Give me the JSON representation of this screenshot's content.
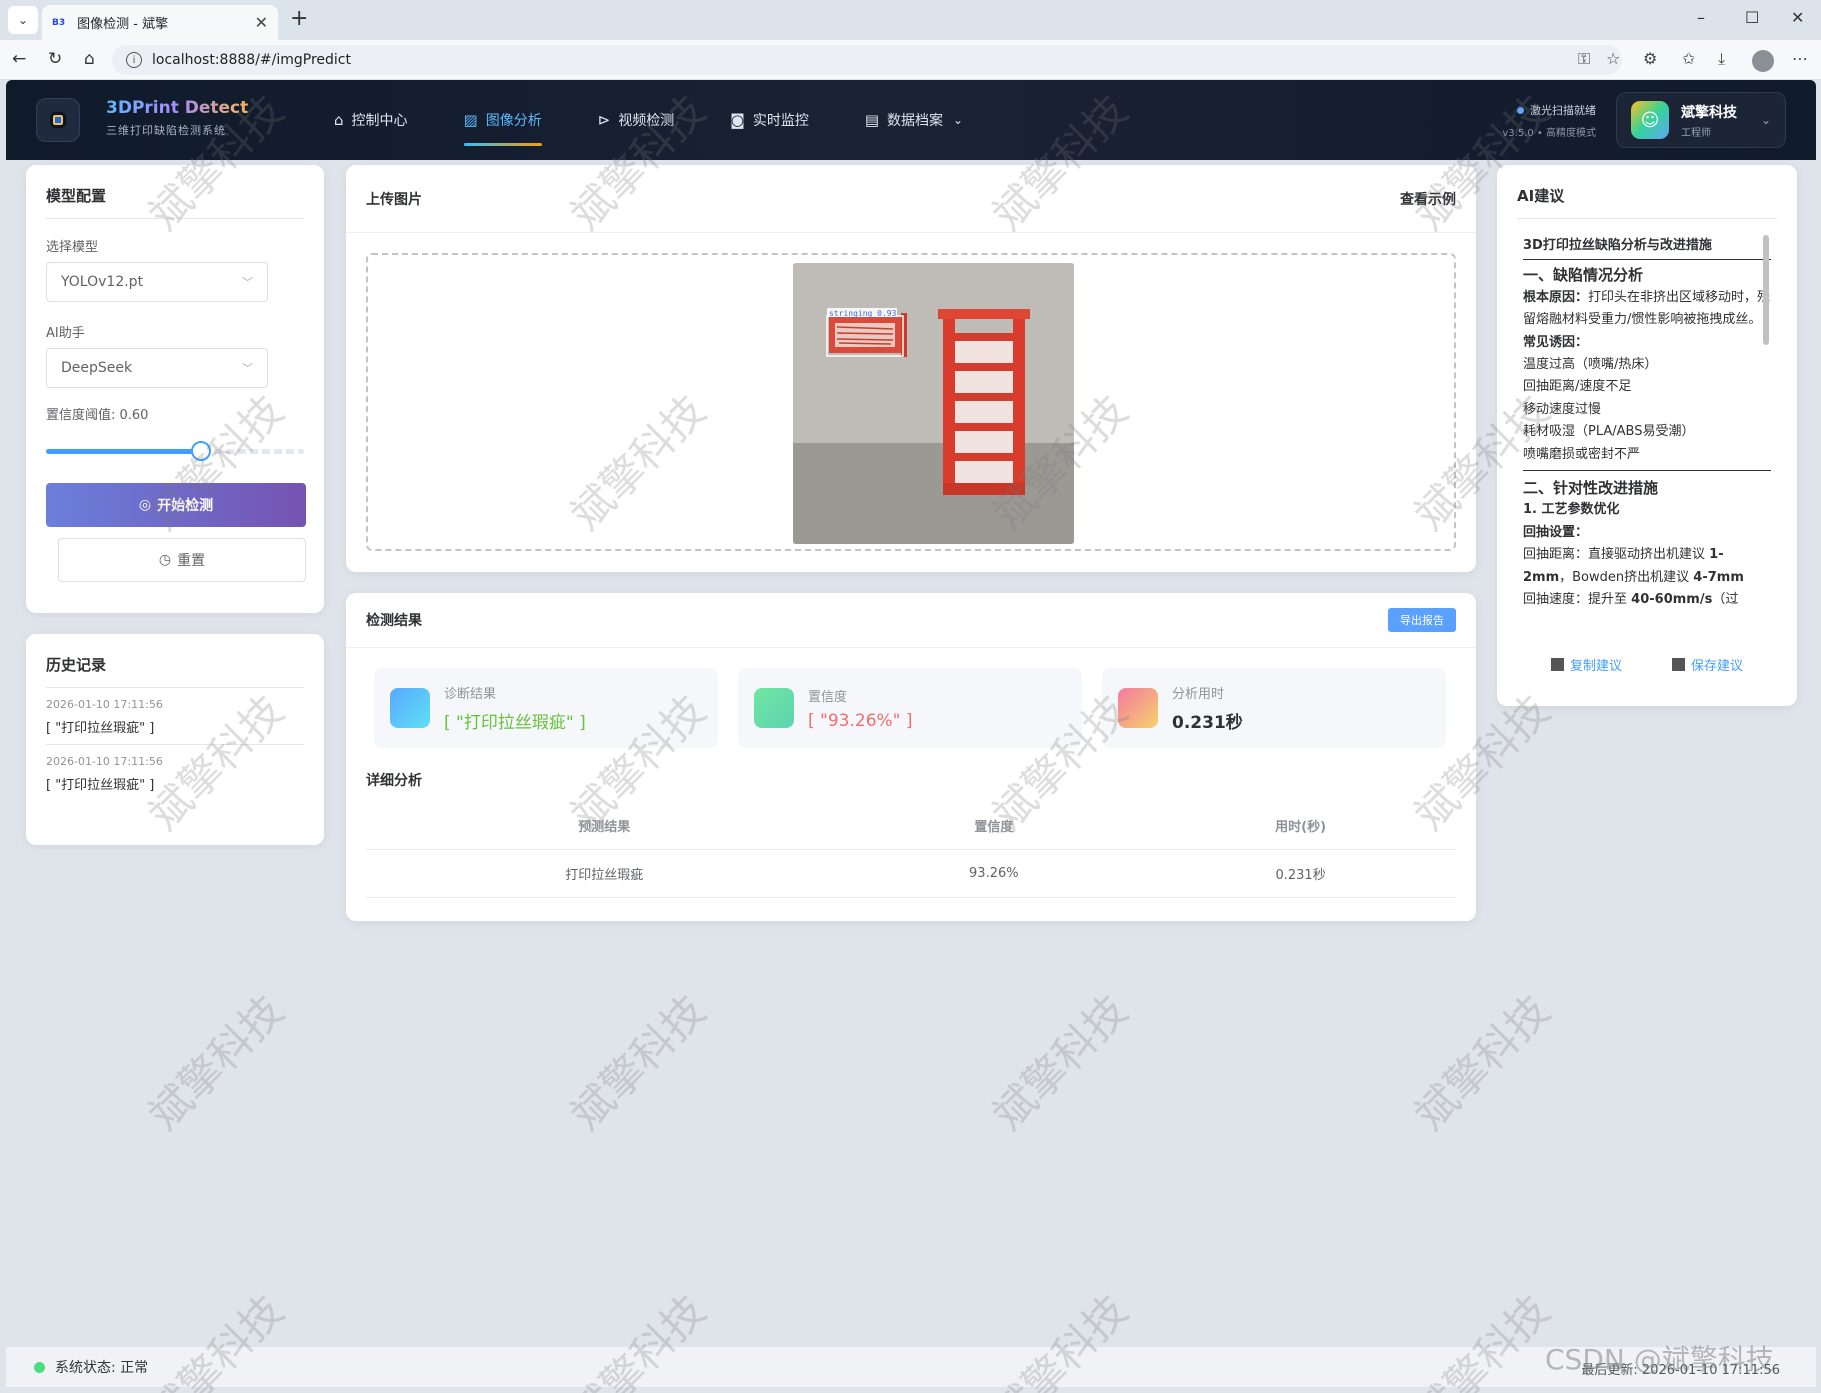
{
  "browser": {
    "tab_title": "图像检测 - 斌擎",
    "favicon_text": "B3",
    "url": "localhost:8888/#/imgPredict"
  },
  "header": {
    "brand_title": "3DPrint Detect",
    "brand_subtitle": "三维打印缺陷检测系统",
    "nav": [
      {
        "label": "控制中心",
        "icon": "home-icon"
      },
      {
        "label": "图像分析",
        "icon": "image-icon",
        "active": true
      },
      {
        "label": "视频检测",
        "icon": "play-circle-icon"
      },
      {
        "label": "实时监控",
        "icon": "camera-icon"
      },
      {
        "label": "数据档案",
        "icon": "document-icon",
        "has_dropdown": true
      }
    ],
    "status_text": "激光扫描就绪",
    "version_text": "v3.5.0 • 高精度模式",
    "user_name": "斌擎科技",
    "user_role": "工程师"
  },
  "config": {
    "title": "模型配置",
    "model_label": "选择模型",
    "model_value": "YOLOv12.pt",
    "ai_label": "AI助手",
    "ai_value": "DeepSeek",
    "confidence_label": "置信度阈值: 0.60",
    "confidence_value": 0.6,
    "start_label": "开始检测",
    "reset_label": "重置"
  },
  "history": {
    "title": "历史记录",
    "items": [
      {
        "time": "2026-01-10 17:11:56",
        "label": "[ \"打印拉丝瑕疵\" ]"
      },
      {
        "time": "2026-01-10 17:11:56",
        "label": "[ \"打印拉丝瑕疵\" ]"
      }
    ]
  },
  "upload": {
    "title": "上传图片",
    "example_link": "查看示例",
    "detection_box_label": "stringing 0.93"
  },
  "result": {
    "title": "检测结果",
    "export_label": "导出报告",
    "stats": [
      {
        "label": "诊断结果",
        "value": "[ \"打印拉丝瑕疵\" ]",
        "color": "#67c23a"
      },
      {
        "label": "置信度",
        "value": "[ \"93.26%\" ]",
        "color": "#f56c6c"
      },
      {
        "label": "分析用时",
        "value": "0.231秒",
        "color": "#303133"
      }
    ],
    "detail_title": "详细分析",
    "table_headers": [
      "预测结果",
      "置信度",
      "用时(秒)"
    ],
    "table_rows": [
      [
        "打印拉丝瑕疵",
        "93.26%",
        "0.231秒"
      ]
    ]
  },
  "ai": {
    "title": "AI建议",
    "doc_title": "3D打印拉丝缺陷分析与改进措施",
    "section1": "一、缺陷情况分析",
    "cause_label": "根本原因：",
    "cause_text": "打印头在非挤出区域移动时，残留熔融材料受重力/惯性影响被拖拽成丝。",
    "common_label": "常见诱因：",
    "causes": [
      "温度过高（喷嘴/热床）",
      "回抽距离/速度不足",
      "移动速度过慢",
      "耗材吸湿（PLA/ABS易受潮）",
      "喷嘴磨损或密封不严"
    ],
    "section2": "二、针对性改进措施",
    "sub1": "1. 工艺参数优化",
    "retract_label": "回抽设置：",
    "retract_distance_text": "回抽距离：直接驱动挤出机建议",
    "retract_distance_val1": "1-2mm",
    "retract_distance_mid": "，Bowden挤出机建议",
    "retract_distance_val2": "4-7mm",
    "retract_speed_text": "回抽速度：提升至",
    "retract_speed_val": "40-60mm/s",
    "retract_speed_tail": "（过",
    "copy_label": "复制建议",
    "save_label": "保存建议"
  },
  "footer": {
    "status": "系统状态: 正常",
    "last_update": "最后更新: 2026-01-10 17:11:56"
  },
  "watermark": "斌擎科技",
  "csdn_mark": "CSDN @斌擎科技"
}
